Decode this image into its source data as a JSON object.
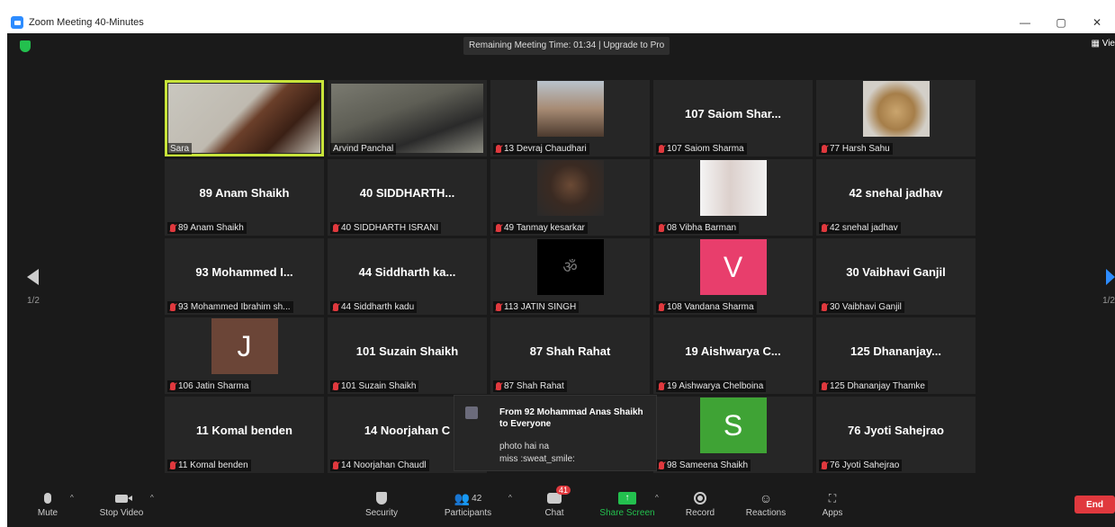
{
  "window": {
    "title": "Zoom Meeting 40-Minutes",
    "controls": [
      "—",
      "▢",
      "✕"
    ]
  },
  "banner": "Remaining Meeting Time: 01:34 | Upgrade to Pro",
  "view_label": "Vie",
  "pagination": {
    "left": "1/2",
    "right": "1/2"
  },
  "tiles": [
    {
      "kind": "video",
      "video": "cam-sara",
      "label": "Sara",
      "muted": false,
      "active": true
    },
    {
      "kind": "video",
      "video": "cam-arvind",
      "label": "Arvind Panchal",
      "muted": false
    },
    {
      "kind": "thumb",
      "thumb": "couple",
      "label": "13 Devraj Chaudhari",
      "muted": true
    },
    {
      "kind": "name",
      "bigname": "107 Saiom Shar...",
      "label": "107 Saiom Sharma",
      "muted": true
    },
    {
      "kind": "thumb",
      "thumb": "duck",
      "label": "77 Harsh Sahu",
      "muted": true
    },
    {
      "kind": "name",
      "bigname": "89 Anam Shaikh",
      "label": "89 Anam Shaikh",
      "muted": true
    },
    {
      "kind": "name",
      "bigname": "40 SIDDHARTH...",
      "label": "40 SIDDHARTH ISRANI",
      "muted": true
    },
    {
      "kind": "thumb",
      "thumb": "tanmay",
      "label": "49 Tanmay kesarkar",
      "muted": true
    },
    {
      "kind": "thumb",
      "thumb": "vibha",
      "label": "08 Vibha Barman",
      "muted": true
    },
    {
      "kind": "name",
      "bigname": "42 snehal jadhav",
      "label": "42 snehal jadhav",
      "muted": true
    },
    {
      "kind": "name",
      "bigname": "93 Mohammed I...",
      "label": "93 Mohammed Ibrahim sh...",
      "muted": true
    },
    {
      "kind": "name",
      "bigname": "44 Siddharth ka...",
      "label": "44 Siddharth kadu",
      "muted": true
    },
    {
      "kind": "thumb",
      "thumb": "om",
      "glyph": "ॐ",
      "label": "113 JATIN SINGH",
      "muted": true
    },
    {
      "kind": "avatar",
      "letter": "V",
      "color": "#e83e6c",
      "label": "108 Vandana Sharma",
      "muted": true
    },
    {
      "kind": "name",
      "bigname": "30 Vaibhavi Ganjil",
      "label": "30 Vaibhavi Ganjil",
      "muted": true
    },
    {
      "kind": "avatar",
      "letter": "J",
      "color": "#6b4537",
      "label": "106 Jatin Sharma",
      "muted": true
    },
    {
      "kind": "name",
      "bigname": "101 Suzain Shaikh",
      "label": "101 Suzain Shaikh",
      "muted": true
    },
    {
      "kind": "name",
      "bigname": "87 Shah Rahat",
      "label": "87 Shah Rahat",
      "muted": true
    },
    {
      "kind": "name",
      "bigname": "19 Aishwarya C...",
      "label": "19 Aishwarya Chelboina",
      "muted": true
    },
    {
      "kind": "name",
      "bigname": "125 Dhananjay...",
      "label": "125 Dhananjay Thamke",
      "muted": true
    },
    {
      "kind": "name",
      "bigname": "11 Komal benden",
      "label": "11 Komal benden",
      "muted": true
    },
    {
      "kind": "name",
      "bigname": "14 Noorjahan C",
      "label": "14 Noorjahan Chaudl",
      "muted": true
    },
    {
      "kind": "empty"
    },
    {
      "kind": "avatar",
      "letter": "S",
      "color": "#3fa335",
      "label": "98 Sameena Shaikh",
      "muted": true
    },
    {
      "kind": "name",
      "bigname": "76 Jyoti Sahejrao",
      "label": "76 Jyoti Sahejrao",
      "muted": true
    }
  ],
  "chat_popup": {
    "from": "From 92 Mohammad Anas Shaikh to Everyone",
    "message_line1": "photo hai na",
    "message_line2": "miss :sweat_smile:"
  },
  "toolbar": {
    "mute": "Mute",
    "stop_video": "Stop Video",
    "security": "Security",
    "participants": "Participants",
    "participants_count": "42",
    "chat": "Chat",
    "chat_badge": "41",
    "share_screen": "Share Screen",
    "record": "Record",
    "reactions": "Reactions",
    "apps": "Apps",
    "end": "End",
    "caret": "^"
  },
  "colors": {
    "active_speaker": "#c8e43a",
    "share_green": "#23c04e",
    "end_red": "#e0393e",
    "brand_blue": "#2d8cff"
  }
}
